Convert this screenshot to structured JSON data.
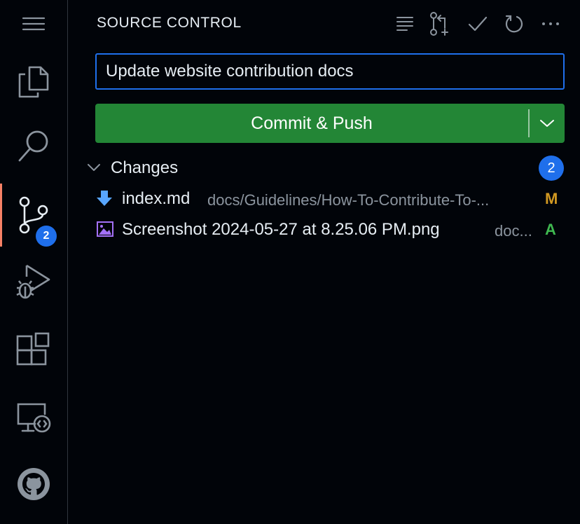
{
  "activity_bar": {
    "items": [
      {
        "name": "menu-icon"
      },
      {
        "name": "explorer-icon"
      },
      {
        "name": "search-icon"
      },
      {
        "name": "source-control-icon",
        "badge": "2",
        "active": true
      },
      {
        "name": "run-debug-icon"
      },
      {
        "name": "extensions-icon"
      },
      {
        "name": "remote-explorer-icon"
      },
      {
        "name": "github-icon"
      }
    ]
  },
  "panel": {
    "title": "SOURCE CONTROL",
    "toolbar": [
      "view-as-tree-icon",
      "create-pull-request-icon",
      "commit-check-icon",
      "refresh-icon",
      "more-actions-icon"
    ]
  },
  "commit": {
    "message": "Update website contribution docs",
    "button_label": "Commit & Push"
  },
  "changes": {
    "label": "Changes",
    "count": "2",
    "files": [
      {
        "name": "index.md",
        "path": "docs/Guidelines/How-To-Contribute-To-...",
        "status": "M",
        "status_color": "#d29922",
        "icon": "markdown-file-icon",
        "icon_color": "#58a6ff"
      },
      {
        "name": "Screenshot 2024-05-27 at 8.25.06 PM.png",
        "path": "doc...",
        "status": "A",
        "status_color": "#3fb950",
        "icon": "image-file-icon",
        "icon_color": "#a371f7"
      }
    ]
  },
  "colors": {
    "accent": "#1f6feb",
    "commit_button": "#238636",
    "active_indicator": "#f78166",
    "background": "#010409"
  }
}
